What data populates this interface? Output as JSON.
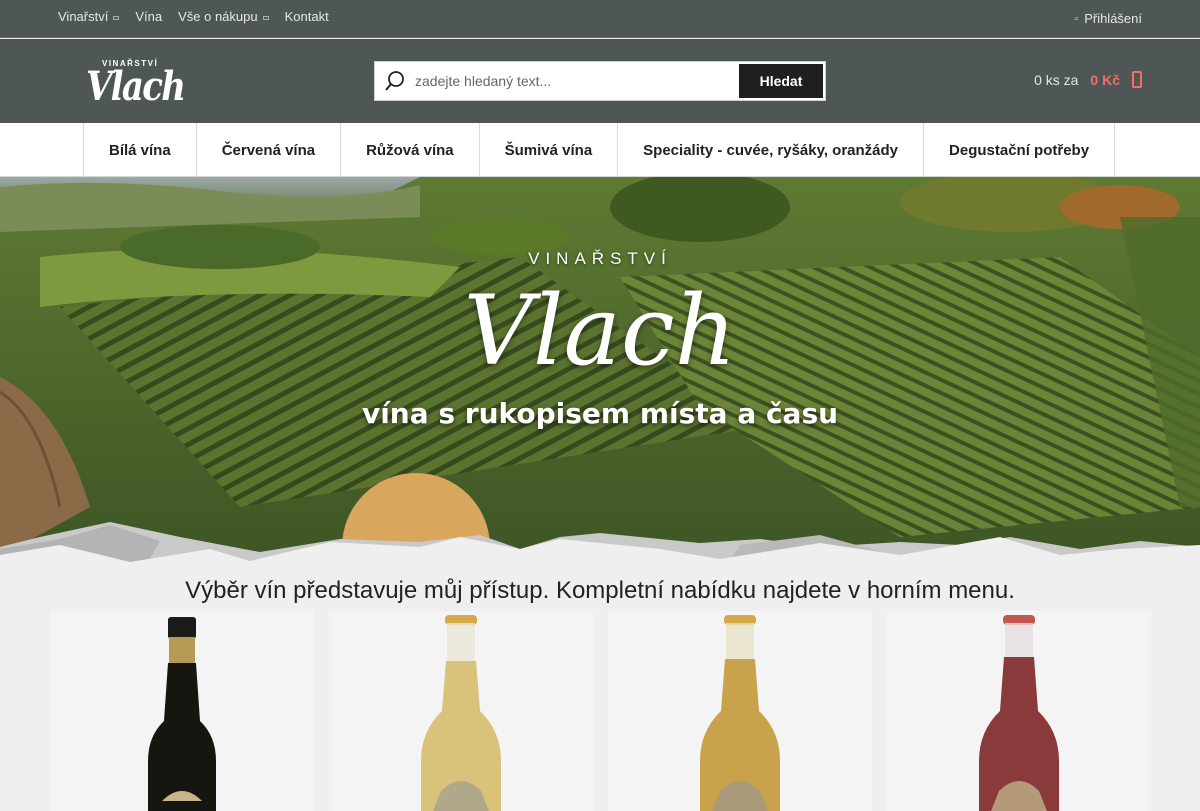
{
  "topnav": {
    "items": [
      {
        "label": "Vinařství",
        "dropdown": true
      },
      {
        "label": "Vína",
        "dropdown": false
      },
      {
        "label": "Vše o nákupu",
        "dropdown": true
      },
      {
        "label": "Kontakt",
        "dropdown": false
      }
    ],
    "login_label": "Přihlášení"
  },
  "logo": {
    "small": "VINAŘSTVÍ",
    "big": "Vlach"
  },
  "search": {
    "placeholder": "zadejte hledaný text...",
    "button_label": "Hledat"
  },
  "cart": {
    "count_label": "0 ks za",
    "price": "0 Kč"
  },
  "mainnav": {
    "items": [
      "Bílá vína",
      "Červená vína",
      "Růžová vína",
      "Šumivá vína",
      "Speciality - cuvée, ryšáky, oranžády",
      "Degustační potřeby"
    ]
  },
  "hero": {
    "overline": "VINAŘSTVÍ",
    "title": "Vlach",
    "tagline": "vína s rukopisem místa a času"
  },
  "intro": "Výběr vín představuje můj přístup. Kompletní nabídku najdete v horním menu.",
  "products": [
    {
      "wine": "dark",
      "capsule": "black"
    },
    {
      "wine": "#d9c27a",
      "capsule": "gold"
    },
    {
      "wine": "#c9a24c",
      "capsule": "gold"
    },
    {
      "wine": "#8a3a3a",
      "capsule": "red"
    }
  ],
  "colors": {
    "header_bg": "#4f5656",
    "accent_price": "#f46d6d",
    "sun": "#d9a65e"
  }
}
